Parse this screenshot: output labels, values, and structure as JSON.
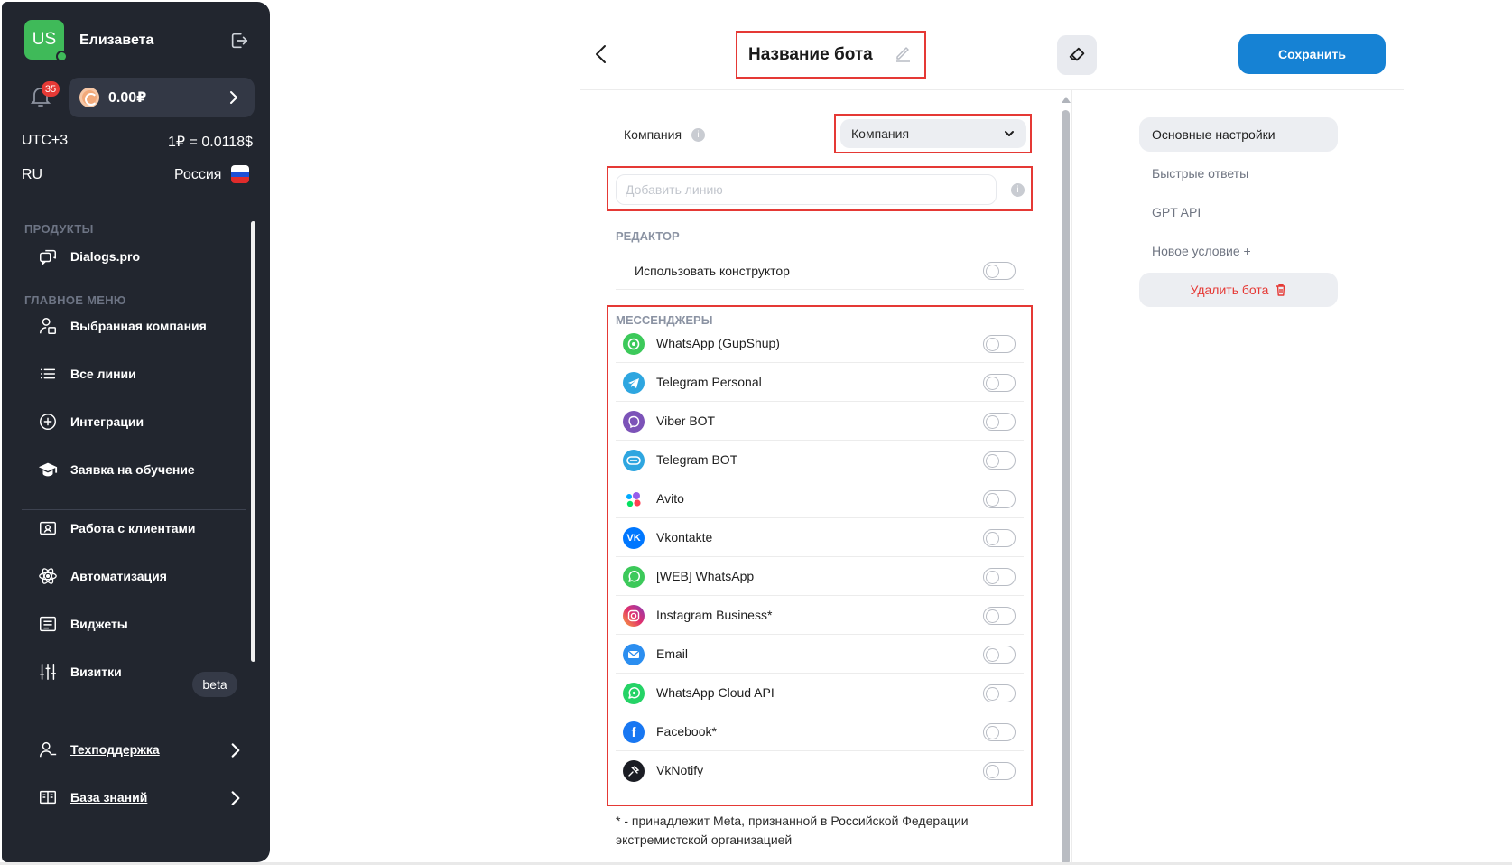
{
  "sidebar": {
    "avatar_initials": "US",
    "user_name": "Елизавета",
    "notifications_count": "35",
    "balance": "0.00₽",
    "timezone": "UTC+3",
    "rate": "1₽ = 0.0118$",
    "language": "RU",
    "country": "Россия",
    "section_products": "ПРОДУКТЫ",
    "product_dialogs": "Dialogs.pro",
    "section_main_menu": "ГЛАВНОЕ МЕНЮ",
    "items": [
      {
        "label": "Выбранная компания",
        "icon": "company-user-icon"
      },
      {
        "label": "Все линии",
        "icon": "list-icon"
      },
      {
        "label": "Интеграции",
        "icon": "plus-circle-icon"
      },
      {
        "label": "Заявка на обучение",
        "icon": "graduation-cap-icon"
      },
      {
        "label": "Работа с клиентами",
        "icon": "contact-card-icon"
      },
      {
        "label": "Автоматизация",
        "icon": "atom-icon"
      },
      {
        "label": "Виджеты",
        "icon": "widget-icon"
      },
      {
        "label": "Визитки",
        "icon": "sliders-icon"
      }
    ],
    "beta_badge": "beta",
    "support": "Техподдержка",
    "knowledge_base": "База знаний",
    "colors": {
      "background": "#22262f",
      "avatar": "#3fba59",
      "badge": "#e53935"
    }
  },
  "header": {
    "bot_title": "Название бота",
    "save_label": "Сохранить",
    "accent": "#1682d4"
  },
  "form": {
    "company_label": "Компания",
    "company_select_value": "Компания",
    "line_placeholder": "Добавить линию",
    "editor_section": "РЕДАКТОР",
    "constructor_label": "Использовать конструктор",
    "constructor_enabled": false,
    "messengers_section": "МЕССЕНДЖЕРЫ",
    "messengers": [
      {
        "label": "WhatsApp (GupShup)",
        "icon": "whatsapp-gupshup-icon",
        "enabled": false
      },
      {
        "label": "Telegram Personal",
        "icon": "telegram-icon",
        "enabled": false
      },
      {
        "label": "Viber BOT",
        "icon": "viber-icon",
        "enabled": false
      },
      {
        "label": "Telegram BOT",
        "icon": "telegram-bot-icon",
        "enabled": false
      },
      {
        "label": "Avito",
        "icon": "avito-icon",
        "enabled": false
      },
      {
        "label": "Vkontakte",
        "icon": "vk-icon",
        "enabled": false
      },
      {
        "label": "[WEB] WhatsApp",
        "icon": "whatsapp-icon",
        "enabled": false
      },
      {
        "label": "Instagram Business*",
        "icon": "instagram-icon",
        "enabled": false
      },
      {
        "label": "Email",
        "icon": "email-icon",
        "enabled": false
      },
      {
        "label": "WhatsApp Cloud API",
        "icon": "whatsapp-cloud-icon",
        "enabled": false
      },
      {
        "label": "Facebook*",
        "icon": "facebook-icon",
        "enabled": false
      },
      {
        "label": "VkNotify",
        "icon": "vknotify-icon",
        "enabled": false
      }
    ],
    "footnote": "* - принадлежит Meta, признанной в Российской Федерации экстремистской организацией"
  },
  "right_nav": {
    "main_settings": "Основные настройки",
    "quick_replies": "Быстрые ответы",
    "gpt_api": "GPT API",
    "new_condition": "Новое условие +",
    "delete_bot": "Удалить бота"
  }
}
